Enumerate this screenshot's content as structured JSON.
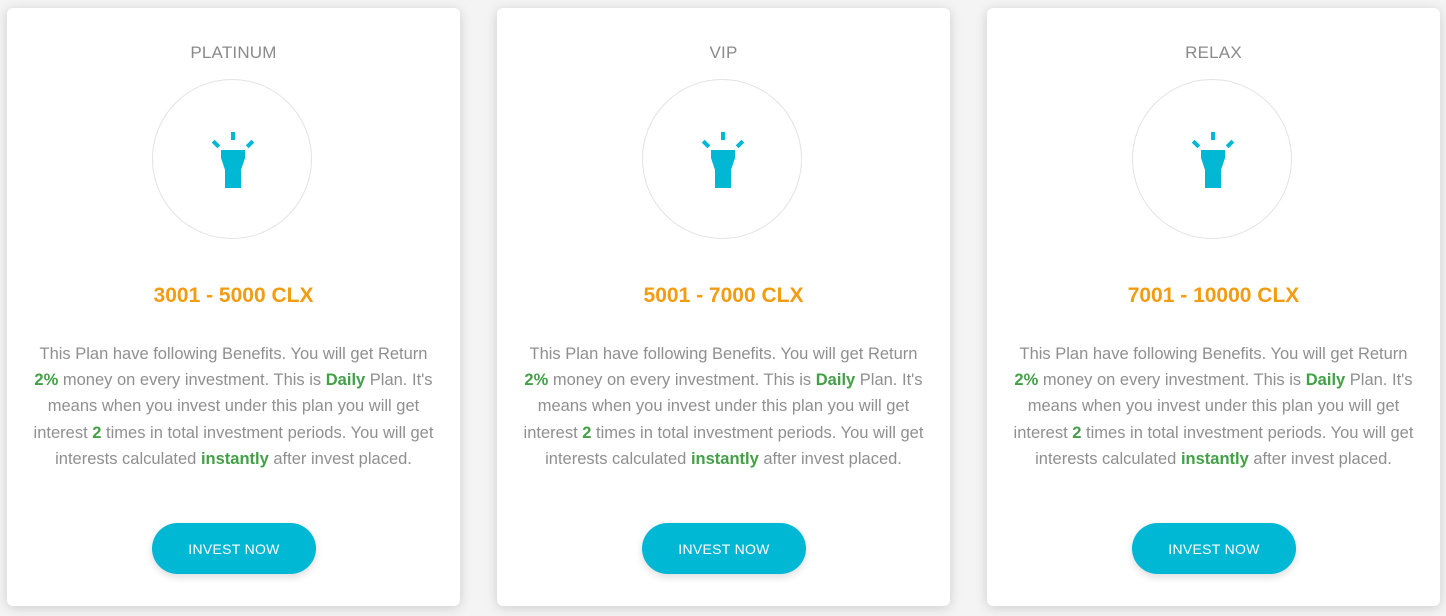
{
  "colors": {
    "accent": "#00b7d4",
    "range": "#f39c12",
    "highlight": "#43a047",
    "text_muted": "#8f8f8f"
  },
  "plans": [
    {
      "name": "PLATINUM",
      "icon": "lamp-icon",
      "range": "3001 - 5000 CLX",
      "desc": {
        "t1": "This Plan have following Benefits. You will get Return ",
        "rate": "2%",
        "t2": " money on every investment. This is ",
        "frequency": "Daily",
        "t3": " Plan. It's means when you invest under this plan you will get interest ",
        "times": "2",
        "t4": " times in total investment periods. You will get interests calculated ",
        "calc": "instantly",
        "t5": " after invest placed."
      },
      "button": "INVEST NOW"
    },
    {
      "name": "VIP",
      "icon": "lamp-icon",
      "range": "5001 - 7000 CLX",
      "desc": {
        "t1": "This Plan have following Benefits. You will get Return ",
        "rate": "2%",
        "t2": " money on every investment. This is ",
        "frequency": "Daily",
        "t3": " Plan. It's means when you invest under this plan you will get interest ",
        "times": "2",
        "t4": " times in total investment periods. You will get interests calculated ",
        "calc": "instantly",
        "t5": " after invest placed."
      },
      "button": "INVEST NOW"
    },
    {
      "name": "RELAX",
      "icon": "lamp-icon",
      "range": "7001 - 10000 CLX",
      "desc": {
        "t1": "This Plan have following Benefits. You will get Return ",
        "rate": "2%",
        "t2": " money on every investment. This is ",
        "frequency": "Daily",
        "t3": " Plan. It's means when you invest under this plan you will get interest ",
        "times": "2",
        "t4": " times in total investment periods. You will get interests calculated ",
        "calc": "instantly",
        "t5": " after invest placed."
      },
      "button": "INVEST NOW"
    }
  ]
}
